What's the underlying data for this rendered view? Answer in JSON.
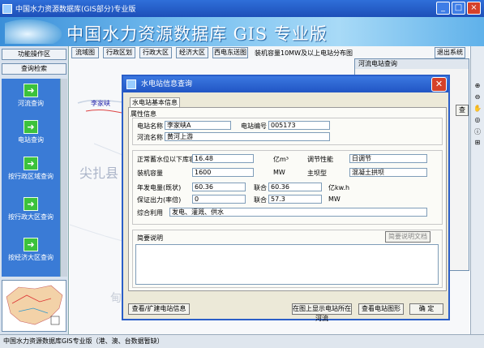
{
  "window": {
    "title": "中国水力资源数据库(GIS部分)专业版",
    "min_label": "_",
    "max_label": "□",
    "close_label": "×"
  },
  "banner": {
    "title": "中国水力资源数据库 GIS 专业版"
  },
  "left": {
    "func_area": "功能操作区",
    "query": "查询检索",
    "nav_items": [
      "河流查询",
      "电站查询",
      "按行政区域查询",
      "按行政大区查询",
      "按经济大区查询"
    ],
    "nav_arrow": "➜"
  },
  "toolbar": {
    "items": [
      "流域图",
      "行政区划",
      "行政大区",
      "经济大区",
      "西电东送图"
    ],
    "caption": "装机容量10MW及以上电站分布图",
    "exit": "退出系统"
  },
  "map": {
    "label1": "李家峡",
    "label2": "尖扎县",
    "label3": "甸"
  },
  "side_window": {
    "title": "河流电站查询",
    "btn": "查"
  },
  "status": {
    "text": "中国水力资源数据库GIS专业版（港、澳、台数据暂缺）"
  },
  "dialog": {
    "title": "水电站信息查询",
    "tab": "水电站基本信息",
    "attr_header": "属性信息",
    "fields": {
      "station_name_label": "电站名称",
      "station_name": "李家峡A",
      "station_code_label": "电站编号",
      "station_code": "005173",
      "river_label": "河流名称",
      "river": "黄河上游",
      "storage_label": "正常蓄水位以下库容",
      "storage": "16.48",
      "storage_unit": "亿m³",
      "regulation_label": "调节性能",
      "regulation": "日调节",
      "capacity_label": "装机容量",
      "capacity": "1600",
      "capacity_unit": "MW",
      "dam_label": "主坝型",
      "dam": "混凝土拱坝",
      "annual_gen_label": "年发电量(既状)",
      "annual_gen": "60.36",
      "annual_gen_joint_label": "联合",
      "annual_gen_joint": "60.36",
      "annual_gen_unit": "亿kw.h",
      "firm_label": "保证出力(率倍)",
      "firm": "0",
      "firm_joint_label": "联合",
      "firm_joint": "57.3",
      "firm_unit": "MW",
      "use_label": "综合利用",
      "use": "发电、灌溉、供水"
    },
    "summary_label": "简要说明",
    "summary_btn": "简要说明文档",
    "buttons": {
      "extend": "查看/扩建电站信息",
      "locate": "在图上显示电站所在河流",
      "view_map": "查看电站图形",
      "ok": "确  定"
    }
  },
  "colors": {
    "title": "#2155c4",
    "banner": "#5fb1ea",
    "nav": "#3a7bd6",
    "nav_btn": "#3cc23c"
  }
}
